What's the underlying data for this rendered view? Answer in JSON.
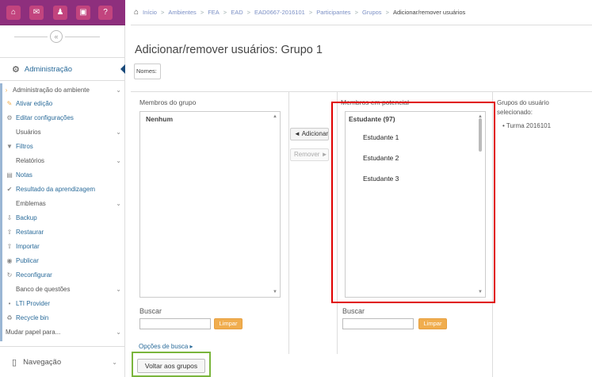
{
  "topbar": {
    "buttons": [
      {
        "icon": "home-icon",
        "glyph": "⌂",
        "color": "#c2447e"
      },
      {
        "icon": "mail-icon",
        "glyph": "✉",
        "color": "#c2447e"
      },
      {
        "icon": "users-icon",
        "glyph": "♟",
        "color": "#c2447e"
      },
      {
        "icon": "book-icon",
        "glyph": "▣",
        "color": "#c2447e"
      },
      {
        "icon": "help-icon",
        "glyph": "?",
        "color": "#c2447e"
      }
    ]
  },
  "breadcrumb": {
    "home_glyph": "⌂",
    "items": [
      "Início",
      "Ambientes",
      "FEA",
      "EAD",
      "EAD0667-2016101",
      "Participantes",
      "Grupos",
      "Adicionar/remover usuários"
    ],
    "separator": ">"
  },
  "sidebar": {
    "collapse_glyph": "«",
    "admin_title": "Administração",
    "admin_icon_glyph": "⚙",
    "tree": [
      {
        "label": "Administração do ambiente",
        "icon": "caret-right-icon",
        "glyph": "›",
        "color": "grey",
        "chevron": true
      },
      {
        "label": "Ativar edição",
        "icon": "pencil-icon",
        "glyph": "✎",
        "color": "blue",
        "chevron": false
      },
      {
        "label": "Editar configurações",
        "icon": "gear-icon",
        "glyph": "⚙",
        "color": "blue",
        "chevron": false
      },
      {
        "label": "Usuários",
        "icon": "",
        "glyph": "",
        "color": "grey",
        "chevron": true
      },
      {
        "label": "Filtros",
        "icon": "filter-icon",
        "glyph": "▼",
        "color": "blue",
        "chevron": false
      },
      {
        "label": "Relatórios",
        "icon": "",
        "glyph": "",
        "color": "grey",
        "chevron": true
      },
      {
        "label": "Notas",
        "icon": "grades-icon",
        "glyph": "▤",
        "color": "blue",
        "chevron": false
      },
      {
        "label": "Resultado da aprendizagem",
        "icon": "outcomes-icon",
        "glyph": "✔",
        "color": "blue",
        "chevron": false
      },
      {
        "label": "Emblemas",
        "icon": "",
        "glyph": "",
        "color": "grey",
        "chevron": true
      },
      {
        "label": "Backup",
        "icon": "backup-icon",
        "glyph": "⇩",
        "color": "blue",
        "chevron": false
      },
      {
        "label": "Restaurar",
        "icon": "restore-icon",
        "glyph": "⇧",
        "color": "blue",
        "chevron": false
      },
      {
        "label": "Importar",
        "icon": "import-icon",
        "glyph": "⇧",
        "color": "blue",
        "chevron": false
      },
      {
        "label": "Publicar",
        "icon": "publish-icon",
        "glyph": "◉",
        "color": "blue",
        "chevron": false
      },
      {
        "label": "Reconfigurar",
        "icon": "reset-icon",
        "glyph": "↻",
        "color": "blue",
        "chevron": false
      },
      {
        "label": "Banco de questões",
        "icon": "",
        "glyph": "",
        "color": "grey",
        "chevron": true
      },
      {
        "label": "LTI Provider",
        "icon": "bullet-icon",
        "glyph": "•",
        "color": "blue",
        "chevron": false
      },
      {
        "label": "Recycle bin",
        "icon": "recycle-icon",
        "glyph": "♻",
        "color": "blue",
        "chevron": false
      },
      {
        "label": "Mudar papel para...",
        "icon": "",
        "glyph": "",
        "color": "grey",
        "chevron": true
      }
    ],
    "nav_title": "Navegação",
    "nav_icon_glyph": "▯"
  },
  "main": {
    "title": "Adicionar/remover usuários: Grupo 1",
    "names_label": "Nomes:",
    "members": {
      "header": "Membros do grupo",
      "options": [
        "Nenhum"
      ],
      "search_label": "Buscar",
      "search_value": "",
      "clear_label": "Limpar"
    },
    "add_label": "◄ Adicionar",
    "remove_label": "Remover ►",
    "potential": {
      "header": "Membros em potencial",
      "group_label": "Estudante (97)",
      "options": [
        "Estudante 1",
        "Estudante 2",
        "Estudante 3"
      ],
      "search_label": "Buscar",
      "search_value": "",
      "clear_label": "Limpar"
    },
    "selected_groups": {
      "header": "Grupos do usuário selecionado:",
      "items": [
        "Turma 2016101"
      ]
    },
    "search_options_label": "Opções de busca ▸",
    "back_label": "Voltar aos grupos"
  },
  "colors": {
    "topbar": "#8e2f7d",
    "link": "#2a6b9a",
    "clear_button": "#f0ad4e",
    "highlight_red": "#e00000",
    "highlight_green": "#7ab53c"
  }
}
